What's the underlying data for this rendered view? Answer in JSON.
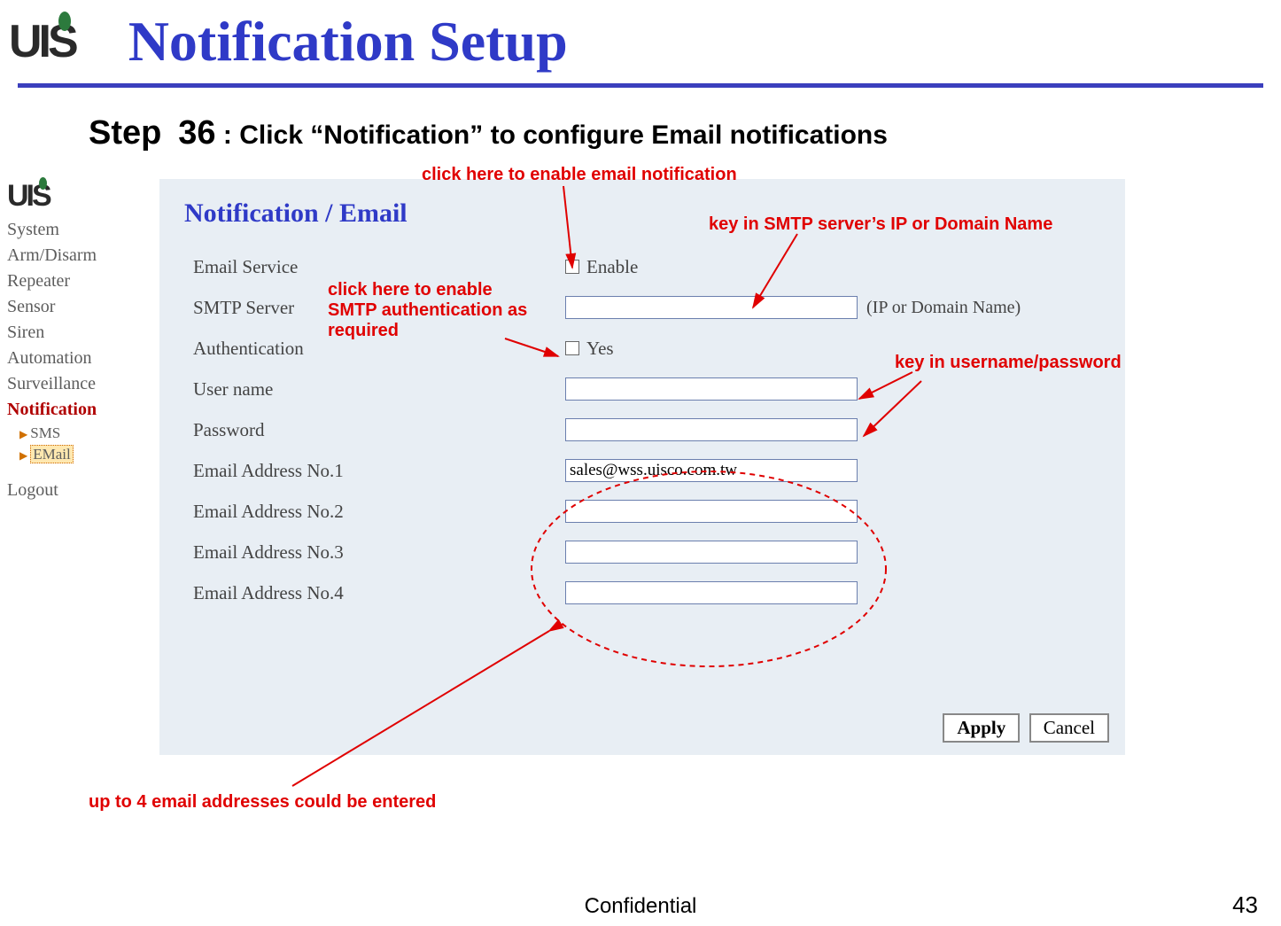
{
  "header": {
    "logo": "UIS",
    "title": "Notification Setup"
  },
  "step": {
    "prefix": "Step",
    "number": "36",
    "sep": " : ",
    "instruction": "Click “Notification” to configure Email notifications"
  },
  "sidebar": {
    "logo": "UIS",
    "items": [
      "System",
      "Arm/Disarm",
      "Repeater",
      "Sensor",
      "Siren",
      "Automation",
      "Surveillance",
      "Notification"
    ],
    "sub_items": [
      "SMS",
      "EMail"
    ],
    "logout": "Logout"
  },
  "panel": {
    "title": "Notification / Email",
    "rows": {
      "email_service_label": "Email Service",
      "enable_label": "Enable",
      "smtp_server_label": "SMTP Server",
      "smtp_hint": "(IP or Domain Name)",
      "auth_label": "Authentication",
      "auth_yes": "Yes",
      "username_label": "User name",
      "password_label": "Password",
      "addr1_label": "Email Address No.1",
      "addr1_value": "sales@wss.uisco.com.tw",
      "addr2_label": "Email Address No.2",
      "addr3_label": "Email Address No.3",
      "addr4_label": "Email Address No.4"
    },
    "buttons": {
      "apply": "Apply",
      "cancel": "Cancel"
    }
  },
  "callouts": {
    "c1": "click here to enable email notification",
    "c2": "key in SMTP server’s IP or Domain Name",
    "c3": "click here to enable SMTP authentication as required",
    "c4": "key in username/password",
    "c5": "up to 4 email addresses could be entered"
  },
  "footer": {
    "text": "Confidential",
    "page": "43"
  }
}
